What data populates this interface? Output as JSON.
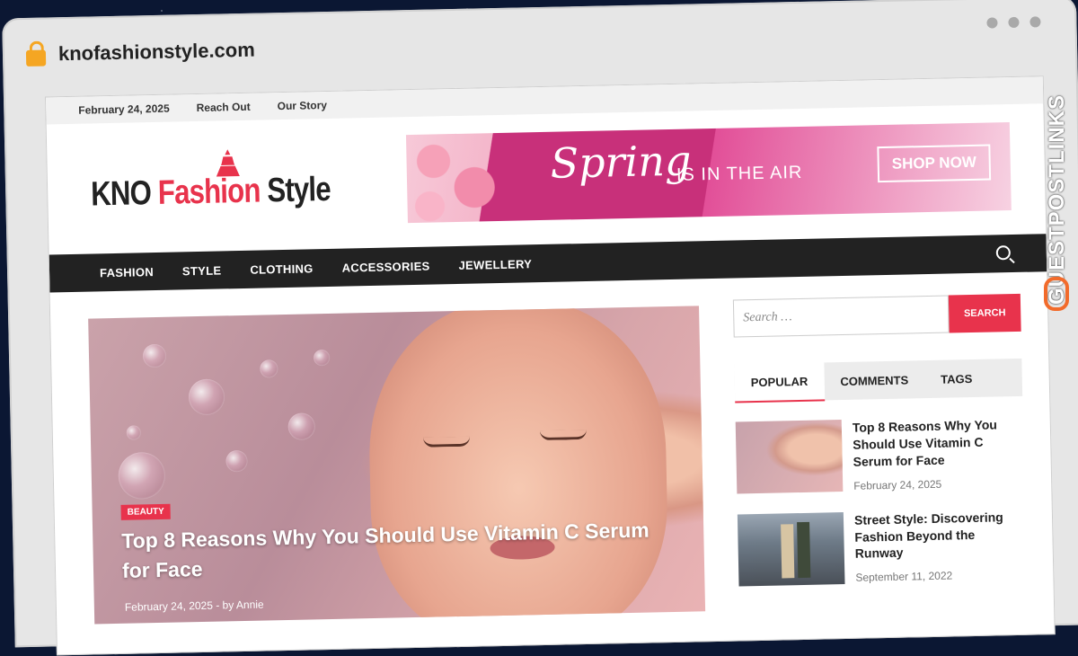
{
  "browser": {
    "url": "knofashionstyle.com"
  },
  "topbar": {
    "date": "February 24, 2025",
    "links": [
      "Reach Out",
      "Our Story"
    ]
  },
  "logo": {
    "part1": "KNO ",
    "part2": "Fashion",
    "part3": " Style"
  },
  "banner": {
    "script": "Spring",
    "text": "IS IN THE AIR",
    "cta": "SHOP NOW"
  },
  "nav": {
    "items": [
      "FASHION",
      "STYLE",
      "CLOTHING",
      "ACCESSORIES",
      "JEWELLERY"
    ]
  },
  "hero": {
    "category": "BEAUTY",
    "title": "Top 8 Reasons Why You Should Use Vitamin C Serum for Face",
    "date": "February 24, 2025",
    "author_prefix": " - by ",
    "author": "Annie"
  },
  "sidebar": {
    "search_placeholder": "Search …",
    "search_button": "SEARCH",
    "tabs": [
      "POPULAR",
      "COMMENTS",
      "TAGS"
    ],
    "posts": [
      {
        "title": "Top 8 Reasons Why You Should Use Vitamin C Serum for Face",
        "date": "February 24, 2025"
      },
      {
        "title": "Street Style: Discovering Fashion Beyond the Runway",
        "date": "September 11, 2022"
      }
    ]
  },
  "watermark": {
    "text": "GUESTPOSTLINKS"
  },
  "colors": {
    "accent": "#e8334c",
    "nav_bg": "#222222",
    "watermark": "#f26b2b"
  }
}
